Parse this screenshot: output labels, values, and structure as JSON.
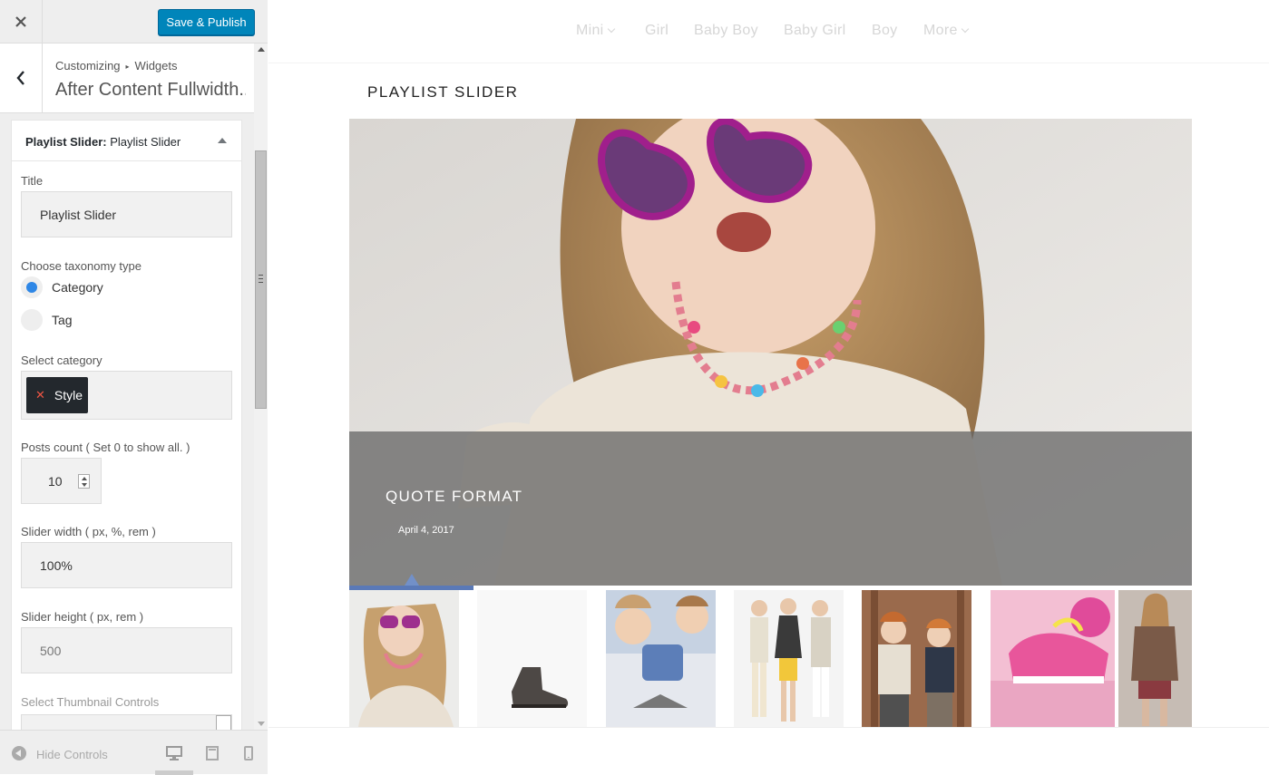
{
  "header": {
    "close_icon": "close-icon",
    "save_label": "Save & Publish",
    "save_color": "#0085ba"
  },
  "section": {
    "breadcrumb_root": "Customizing",
    "breadcrumb_child": "Widgets",
    "title": "After Content Fullwidth..."
  },
  "widget": {
    "name_prefix": "Playlist Slider:",
    "name": "Playlist Slider",
    "fields": {
      "title_label": "Title",
      "title_value": "Playlist Slider",
      "taxonomy_label": "Choose taxonomy type",
      "taxonomy_options": [
        "Category",
        "Tag"
      ],
      "taxonomy_selected": "Category",
      "category_label": "Select category",
      "category_chip": "Style",
      "count_label": "Posts count ( Set 0 to show all. )",
      "count_value": "10",
      "width_label": "Slider width ( px, %, rem )",
      "width_value": "100%",
      "height_label": "Slider height ( px, rem )",
      "height_placeholder": "500",
      "thumb_label": "Select Thumbnail Controls"
    }
  },
  "footer": {
    "hide_label": "Hide Controls",
    "devices": [
      "desktop-icon",
      "tablet-icon",
      "mobile-icon"
    ]
  },
  "preview": {
    "nav": [
      {
        "label": "Mini",
        "dropdown": true
      },
      {
        "label": "Girl",
        "dropdown": false
      },
      {
        "label": "Baby Boy",
        "dropdown": false
      },
      {
        "label": "Baby Girl",
        "dropdown": false
      },
      {
        "label": "Boy",
        "dropdown": false
      },
      {
        "label": "More",
        "dropdown": true
      }
    ],
    "widget_heading": "PLAYLIST SLIDER",
    "slide": {
      "title": "QUOTE FORMAT",
      "date": "April 4, 2017"
    },
    "thumbnails": [
      "girl-sunglasses-thumb",
      "boot-thumb",
      "boys-pillows-thumb",
      "girls-group-thumb",
      "boys-forest-thumb",
      "pink-sneakers-thumb",
      "girl-jacket-thumb"
    ],
    "accent_color": "#5a79b7"
  }
}
